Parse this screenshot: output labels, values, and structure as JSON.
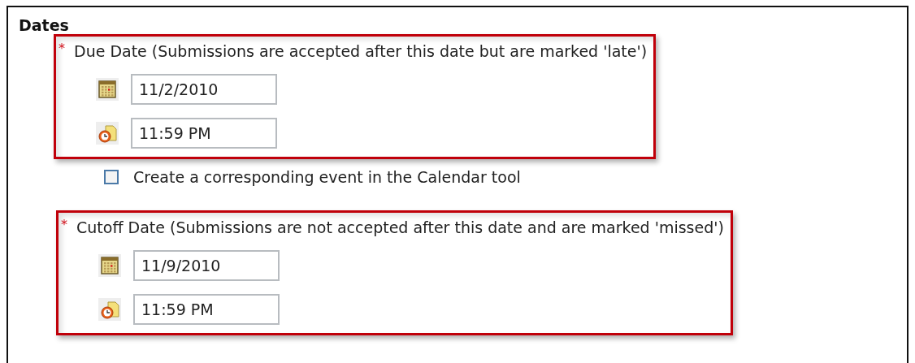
{
  "section": {
    "title": "Dates"
  },
  "due_date": {
    "required": true,
    "required_mark": "*",
    "label": "Due Date (Submissions are accepted after this date but are marked 'late')",
    "date": "11/2/2010",
    "time": "11:59 PM"
  },
  "calendar_event": {
    "checked": false,
    "label": "Create a corresponding event in the Calendar tool"
  },
  "cutoff_date": {
    "required": true,
    "required_mark": "*",
    "label": "Cutoff Date (Submissions are not accepted after this date and are marked 'missed')",
    "date": "11/9/2010",
    "time": "11:59 PM"
  }
}
